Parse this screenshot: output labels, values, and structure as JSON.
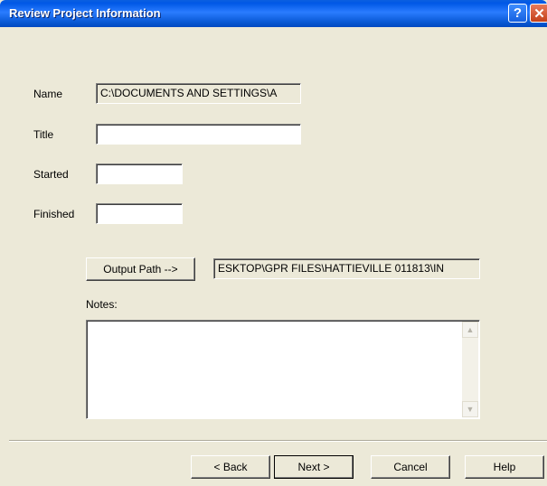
{
  "window": {
    "title": "Review Project Information",
    "help_glyph": "?",
    "close_glyph": "✕"
  },
  "form": {
    "name_label": "Name",
    "name_value": "C:\\DOCUMENTS AND SETTINGS\\A",
    "title_label": "Title",
    "title_value": "",
    "started_label": "Started",
    "started_value": "",
    "finished_label": "Finished",
    "finished_value": "",
    "output_path_button": "Output Path -->",
    "output_path_value": "ESKTOP\\GPR FILES\\HATTIEVILLE 011813\\IN",
    "notes_label": "Notes:",
    "notes_value": ""
  },
  "footer": {
    "back": "< Back",
    "next": "Next >",
    "cancel": "Cancel",
    "help": "Help"
  }
}
